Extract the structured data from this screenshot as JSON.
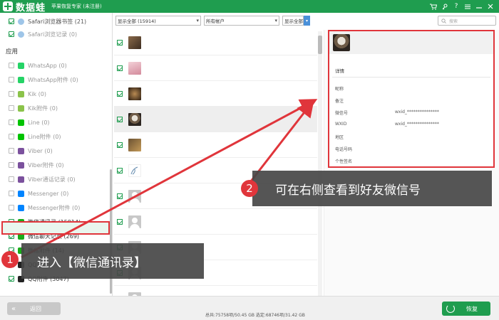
{
  "titlebar": {
    "app_name": "数据蛙",
    "subtitle": "苹果恢复专家 (未注册)",
    "controls": [
      "cart-icon",
      "key-icon",
      "help-icon",
      "menu-icon",
      "minimize-icon",
      "close-icon"
    ]
  },
  "sidebar": {
    "section_title": "应用",
    "items_top": [
      {
        "label": "Safari浏览器书签 (21)",
        "checked": true
      },
      {
        "label": "Safari浏览记录 (0)",
        "checked": true
      }
    ],
    "items": [
      {
        "label": "WhatsApp (0)",
        "icon_color": "#25D366"
      },
      {
        "label": "WhatsApp附件 (0)",
        "icon_color": "#25D366"
      },
      {
        "label": "Kik (0)",
        "icon_color": "#8bc34a"
      },
      {
        "label": "Kik附件 (0)",
        "icon_color": "#8bc34a"
      },
      {
        "label": "Line (0)",
        "icon_color": "#00c300"
      },
      {
        "label": "Line附件 (0)",
        "icon_color": "#00c300"
      },
      {
        "label": "Viber (0)",
        "icon_color": "#7b519d"
      },
      {
        "label": "Viber附件 (0)",
        "icon_color": "#7b519d"
      },
      {
        "label": "Viber通话记录 (0)",
        "icon_color": "#7b519d"
      },
      {
        "label": "Messenger (0)",
        "icon_color": "#0084ff"
      },
      {
        "label": "Messenger附件 (0)",
        "icon_color": "#0084ff"
      },
      {
        "label": "微信通讯录 (15914)",
        "icon_color": "#1aad19",
        "checked": true,
        "active": true
      },
      {
        "label": "微信聊天记录 (269)",
        "icon_color": "#1aad19",
        "checked": true,
        "active": true
      },
      {
        "label": "微信附件 (14)",
        "icon_color": "#1aad19",
        "checked": true,
        "active": true
      },
      {
        "label": "QQ (37)",
        "icon_color": "#222",
        "checked": true,
        "active": true
      },
      {
        "label": "QQ附件 (3047)",
        "icon_color": "#222",
        "checked": true,
        "active": true
      }
    ]
  },
  "filters": {
    "display": "显示全部 (15914)",
    "accounts": "所有帐户",
    "show_all": "显示全部",
    "search_placeholder": "搜索"
  },
  "list": {
    "avatars": [
      "photo-cat",
      "photo-girl",
      "photo-dark",
      "photo-raccoon",
      "photo-animal",
      "photo-sketch",
      "placeholder",
      "placeholder",
      "placeholder",
      "placeholder",
      "placeholder"
    ]
  },
  "detail": {
    "section": "详情",
    "fields": [
      {
        "label": "昵称",
        "value": ""
      },
      {
        "label": "备注",
        "value": ""
      },
      {
        "label": "微信号",
        "value": "wxid_***************"
      },
      {
        "label": "WXID",
        "value": "wxid_***************"
      },
      {
        "label": "地区",
        "value": ""
      },
      {
        "label": "电话号码",
        "value": ""
      },
      {
        "label": "个性签名",
        "value": ""
      }
    ]
  },
  "annotations": {
    "step1_number": "1",
    "step1_text": "进入【微信通讯录】",
    "step2_number": "2",
    "step2_text": "可在右侧查看到好友微信号",
    "color": "#e0353b"
  },
  "bottombar": {
    "back_label": "返回",
    "status": "总共:75758项/50.45 GB 选定:68746项/31.42 GB",
    "recover_label": "恢复"
  },
  "colors": {
    "brand": "#1f9d4f",
    "highlight": "#e0353b"
  }
}
